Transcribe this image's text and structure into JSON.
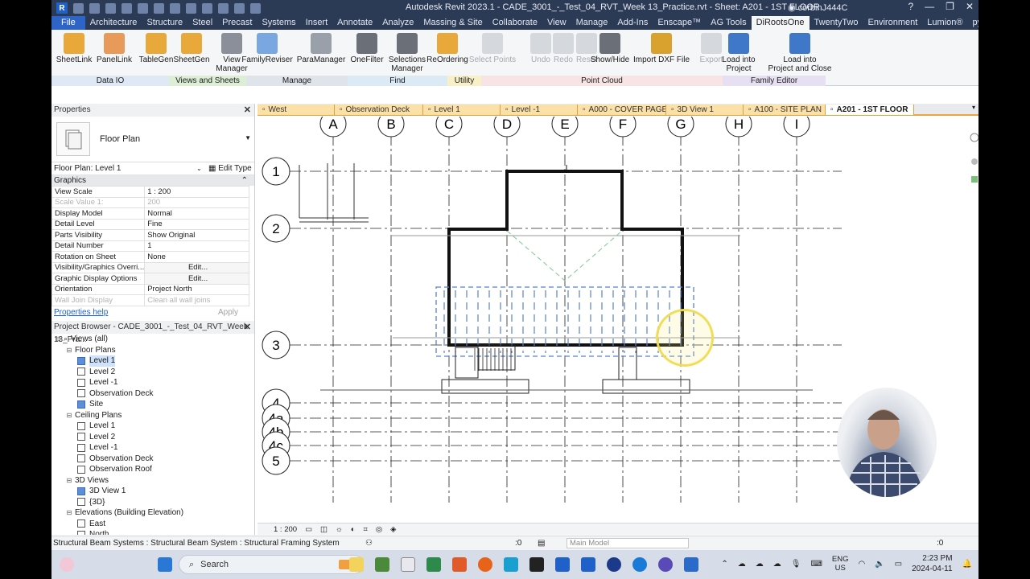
{
  "window": {
    "title": "Autodesk Revit 2023.1 - CADE_3001_-_Test_04_RVT_Week 13_Practice.rvt - Sheet: A201 - 1ST FLOOR",
    "user": "corbinJ444C"
  },
  "ribbon_tabs": [
    "File",
    "Architecture",
    "Structure",
    "Steel",
    "Precast",
    "Systems",
    "Insert",
    "Annotate",
    "Analyze",
    "Massing & Site",
    "Collaborate",
    "View",
    "Manage",
    "Add-Ins",
    "Enscape™",
    "AG Tools",
    "DiRootsOne",
    "TwentyTwo",
    "Environment",
    "Lumion®",
    "pyRevit"
  ],
  "active_ribbon_tab": "DiRootsOne",
  "ribbon_tools": [
    {
      "label": "SheetLink",
      "icon": "sheetlink-icon",
      "color": "#e8a83a"
    },
    {
      "label": "PanelLink",
      "icon": "panellink-icon",
      "color": "#e89a5a"
    },
    {
      "label": "TableGen",
      "icon": "tablegen-icon",
      "color": "#e8a83a"
    },
    {
      "label": "SheetGen",
      "icon": "sheetgen-icon",
      "color": "#e8a83a"
    },
    {
      "label": "View\nManager",
      "icon": "view-manager-icon",
      "color": "#8a8f99"
    },
    {
      "label": "FamilyReviser",
      "icon": "familyreviser-icon",
      "color": "#7aa7e0"
    },
    {
      "label": "ParaManager",
      "icon": "paramanager-icon",
      "color": "#9aa0aa"
    },
    {
      "label": "OneFilter",
      "icon": "onefilter-icon",
      "color": "#6b6f78"
    },
    {
      "label": "Selections\nManager",
      "icon": "selections-manager-icon",
      "color": "#6b6f78"
    },
    {
      "label": "ReOrdering",
      "icon": "reordering-icon",
      "color": "#e8a83a"
    },
    {
      "label": "Select Points",
      "icon": "select-points-icon",
      "color": "#9aa0aa",
      "disabled": true
    },
    {
      "label": "Undo",
      "icon": "undo-icon",
      "color": "#9aa0aa",
      "disabled": true
    },
    {
      "label": "Redo",
      "icon": "redo-icon",
      "color": "#9aa0aa",
      "disabled": true
    },
    {
      "label": "Reset",
      "icon": "reset-icon",
      "color": "#9aa0aa",
      "disabled": true
    },
    {
      "label": "Show/Hide",
      "icon": "show-hide-icon",
      "color": "#6b6f78"
    },
    {
      "label": "Import DXF File",
      "icon": "import-dxf-icon",
      "color": "#d9a12e"
    },
    {
      "label": "Export",
      "icon": "export-icon",
      "color": "#9aa0aa",
      "disabled": true
    },
    {
      "label": "Load into\nProject",
      "icon": "load-into-project-icon",
      "color": "#3f78c8"
    },
    {
      "label": "Load into\nProject and Close",
      "icon": "load-close-icon",
      "color": "#3f78c8"
    }
  ],
  "ribbon_panels": [
    {
      "label": "Data IO",
      "color": "#dfe8f5"
    },
    {
      "label": "Views and Sheets",
      "color": "#dcefd6"
    },
    {
      "label": "Manage",
      "color": "#dfe3ea"
    },
    {
      "label": "Find",
      "color": "#dbeaf5"
    },
    {
      "label": "Utility",
      "color": "#f7f0c8"
    },
    {
      "label": "Point Cloud",
      "color": "#f8e4e4"
    },
    {
      "label": "Family Editor",
      "color": "#e6e0f2"
    }
  ],
  "properties": {
    "header": "Properties",
    "type_name": "Floor Plan",
    "instance": "Floor Plan: Level 1",
    "edit_type": "Edit Type",
    "section": "Graphics",
    "rows": [
      {
        "name": "View Scale",
        "value": "1 : 200"
      },
      {
        "name": "Scale Value    1:",
        "value": "200",
        "dim": true
      },
      {
        "name": "Display Model",
        "value": "Normal"
      },
      {
        "name": "Detail Level",
        "value": "Fine"
      },
      {
        "name": "Parts Visibility",
        "value": "Show Original"
      },
      {
        "name": "Detail Number",
        "value": "1"
      },
      {
        "name": "Rotation on Sheet",
        "value": "None"
      },
      {
        "name": "Visibility/Graphics Overri...",
        "value": "Edit...",
        "button": true
      },
      {
        "name": "Graphic Display Options",
        "value": "Edit...",
        "button": true
      },
      {
        "name": "Orientation",
        "value": "Project North"
      },
      {
        "name": "Wall Join Display",
        "value": "Clean all wall joins",
        "dim": true
      }
    ],
    "help": "Properties help",
    "apply": "Apply"
  },
  "browser": {
    "header": "Project Browser - CADE_3001_-_Test_04_RVT_Week 13_Pra...",
    "items": [
      {
        "label": "Views (all)",
        "level": 0,
        "toggle": "⊟",
        "root": true
      },
      {
        "label": "Floor Plans",
        "level": 1,
        "toggle": "⊟"
      },
      {
        "label": "Level 1",
        "level": 2,
        "view": "blue",
        "selected": true
      },
      {
        "label": "Level 2",
        "level": 2,
        "view": "plain"
      },
      {
        "label": "Level -1",
        "level": 2,
        "view": "plain"
      },
      {
        "label": "Observation Deck",
        "level": 2,
        "view": "plain"
      },
      {
        "label": "Site",
        "level": 2,
        "view": "blue"
      },
      {
        "label": "Ceiling Plans",
        "level": 1,
        "toggle": "⊟"
      },
      {
        "label": "Level 1",
        "level": 2,
        "view": "plain"
      },
      {
        "label": "Level 2",
        "level": 2,
        "view": "plain"
      },
      {
        "label": "Level -1",
        "level": 2,
        "view": "plain"
      },
      {
        "label": "Observation Deck",
        "level": 2,
        "view": "plain"
      },
      {
        "label": "Observation Roof",
        "level": 2,
        "view": "plain"
      },
      {
        "label": "3D Views",
        "level": 1,
        "toggle": "⊟"
      },
      {
        "label": "3D View 1",
        "level": 2,
        "view": "blue"
      },
      {
        "label": "{3D}",
        "level": 2,
        "view": "plain"
      },
      {
        "label": "Elevations (Building Elevation)",
        "level": 1,
        "toggle": "⊟"
      },
      {
        "label": "East",
        "level": 2,
        "view": "plain"
      },
      {
        "label": "North",
        "level": 2,
        "view": "plain"
      }
    ]
  },
  "view_tabs": [
    "West",
    "Observation Deck",
    "Level 1",
    "Level -1",
    "A000 - COVER PAGE",
    "3D View 1",
    "A100 - SITE PLAN",
    "A201 - 1ST FLOOR"
  ],
  "active_view_tab": "A201 - 1ST FLOOR",
  "grids": {
    "columns": [
      "A",
      "B",
      "C",
      "D",
      "E",
      "F",
      "G",
      "H",
      "I"
    ],
    "rows": [
      "1",
      "2",
      "3",
      "4",
      "4a",
      "4b",
      "4c",
      "5"
    ]
  },
  "view_control": {
    "scale": "1 : 200"
  },
  "status": {
    "text": "Structural Beam Systems : Structural Beam System : Structural Framing System",
    "zero": ":0",
    "workset": "Main Model",
    "filter": ":0"
  },
  "taskbar": {
    "search": "Search",
    "lang_top": "ENG",
    "lang_bottom": "US",
    "time": "2:23 PM",
    "date": "2024-04-11"
  }
}
